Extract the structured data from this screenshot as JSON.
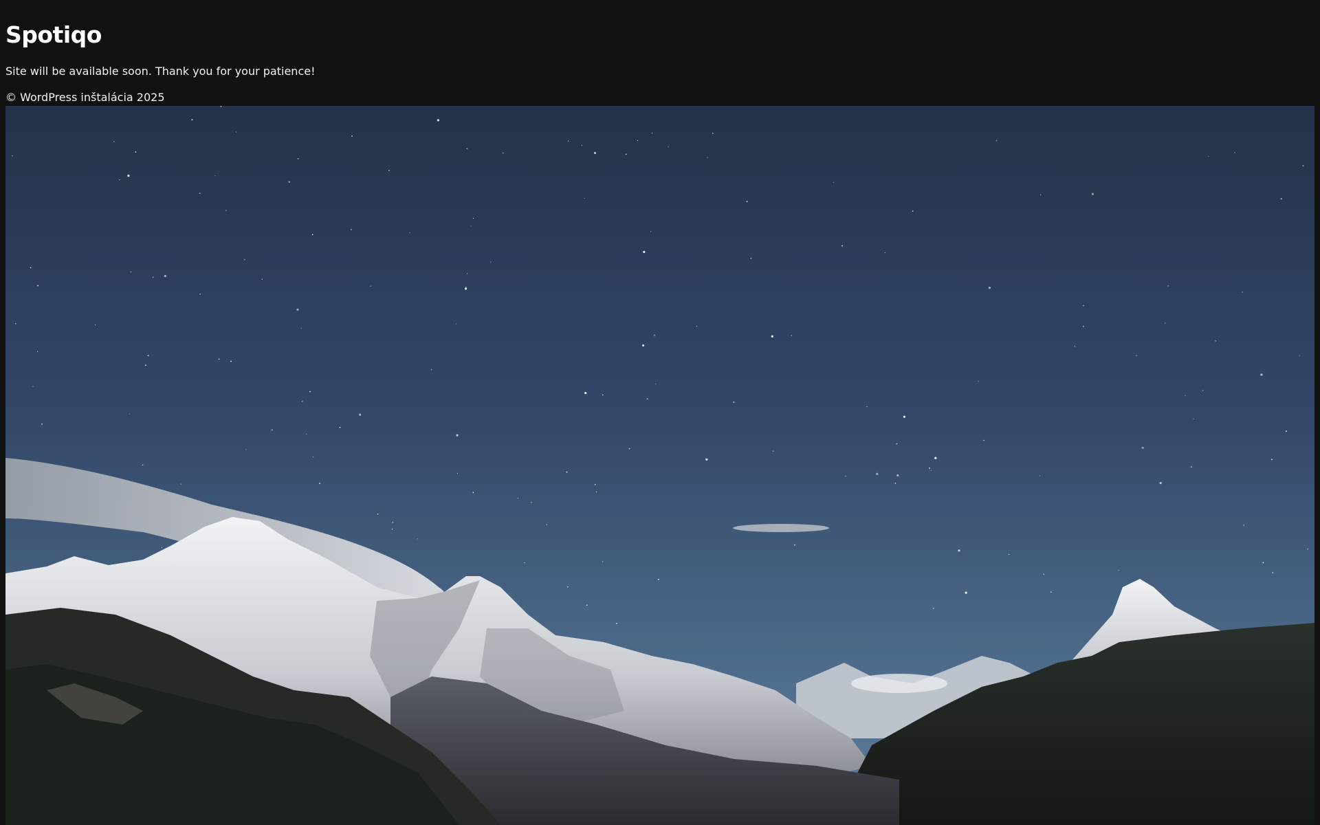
{
  "site": {
    "title": "Spotiqo",
    "message": "Site will be available soon. Thank you for your patience!",
    "footer": "© WordPress inštalácia 2025"
  },
  "hero_image": {
    "subject": "mountain-night-sky-photo",
    "colors": {
      "sky_top": "#24324a",
      "sky_bottom": "#55728f",
      "snow": "#e6e8ec",
      "rock": "#52565e",
      "forest": "#1c221d",
      "page_bg": "#111111"
    }
  }
}
